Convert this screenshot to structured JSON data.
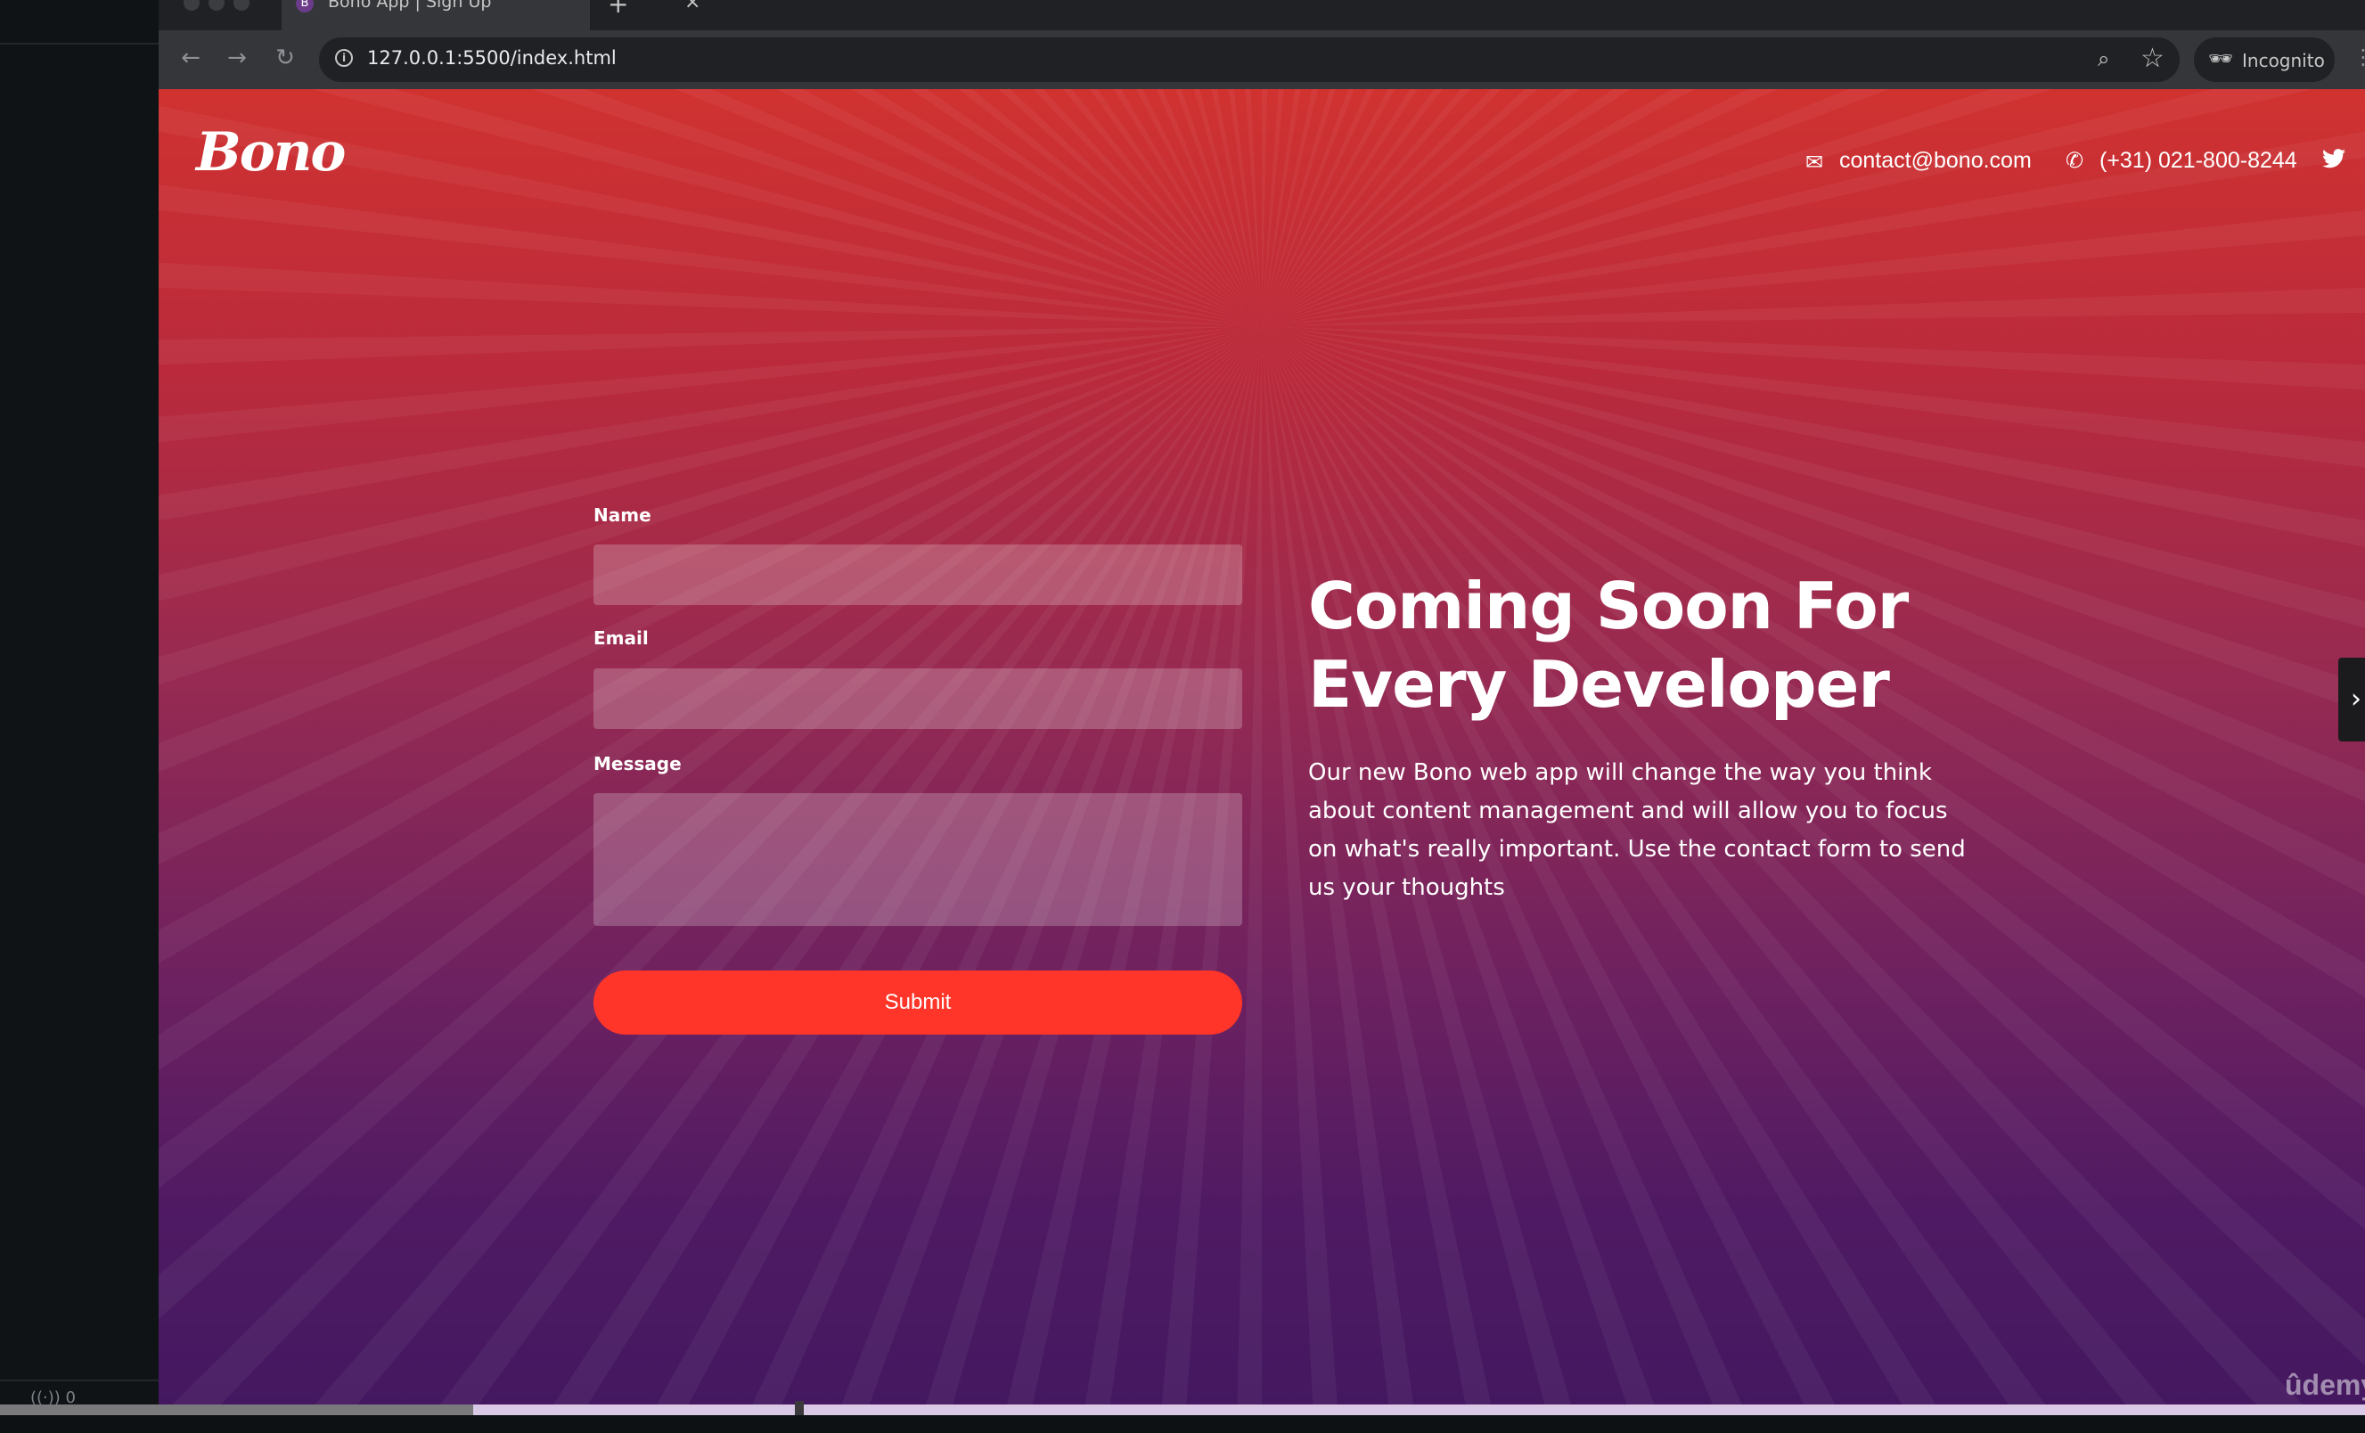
{
  "browser": {
    "tab_title": "Bono App | Sign Up",
    "tab_favicon": "B",
    "url": "127.0.0.1:5500/index.html",
    "incognito_label": "Incognito"
  },
  "icons": {
    "back": "back-arrow-icon",
    "forward": "forward-arrow-icon",
    "reload": "reload-icon",
    "info": "info-icon",
    "zoom": "zoom-icon",
    "bookmark": "star-icon",
    "incognito": "incognito-icon",
    "email": "envelope-icon",
    "phone": "phone-icon",
    "twitter": "twitter-icon"
  },
  "site": {
    "logo": "Bono",
    "email": "contact@bono.com",
    "phone": "(+31) 021-800-8244",
    "form": {
      "name_label": "Name",
      "email_label": "Email",
      "message_label": "Message",
      "submit_label": "Submit"
    },
    "headline": "Coming Soon For Every Developer",
    "blurb": "Our new Bono web app will change the way you think about content management and will allow you to focus on what's really important. Use the contact form to send us your thoughts"
  },
  "watermark": "ûdemy",
  "left_status": "0",
  "video_progress": 0.2,
  "colors": {
    "submit": "#ff3529",
    "gradient_top": "#d03230",
    "gradient_bottom": "#441860"
  }
}
